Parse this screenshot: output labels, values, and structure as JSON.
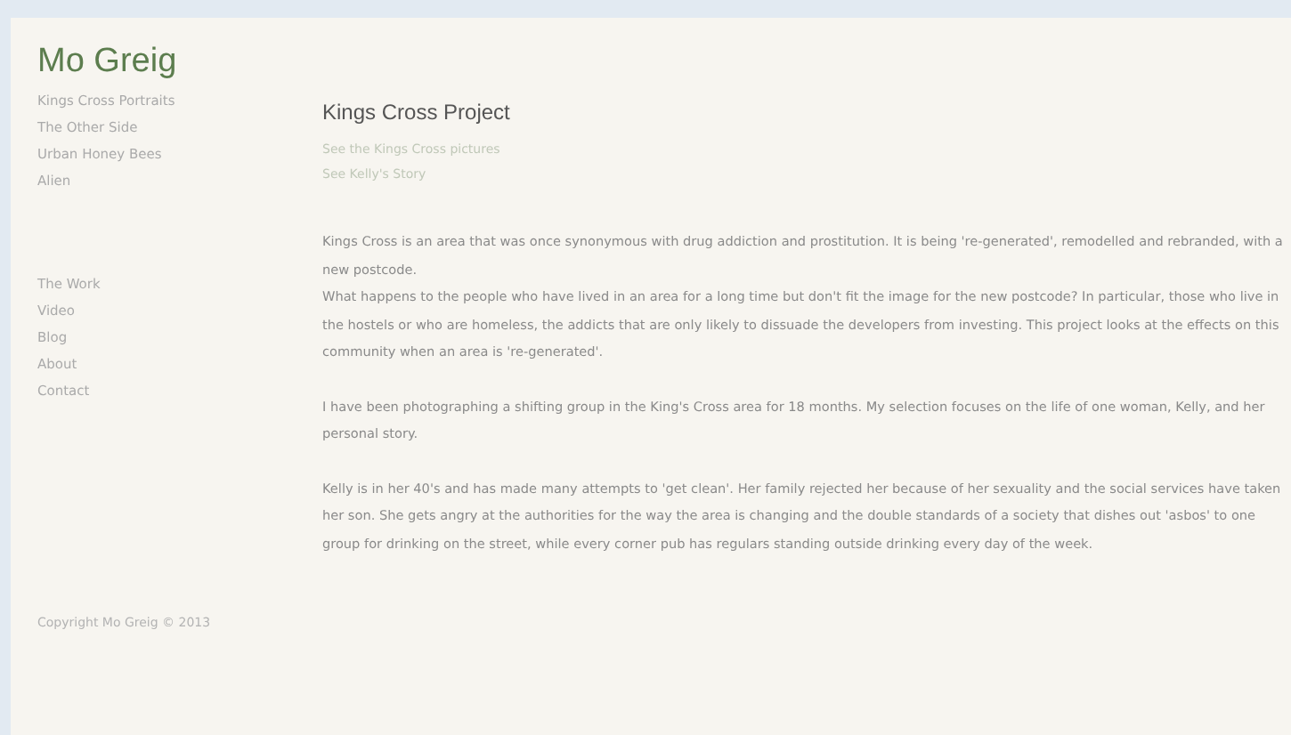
{
  "site_title": "Mo Greig",
  "projects": [
    "Kings Cross Portraits",
    "The Other Side",
    "Urban Honey Bees",
    "Alien"
  ],
  "nav": [
    "The Work",
    "Video",
    "Blog",
    "About",
    "Contact"
  ],
  "copyright": "Copyright Mo Greig © 2013",
  "page_title": "Kings Cross Project",
  "page_links": [
    "See the Kings Cross pictures",
    "See Kelly's Story"
  ],
  "paragraphs": [
    {
      "lines": [
        "Kings Cross is an area that was once synonymous with drug addiction and prostitution. It is being 're-generated', remodelled and rebranded, with a new postcode.",
        "What happens to the people who have lived in an area for a long time but don't fit the image for the new postcode? In particular, those who live in the hostels or who are homeless, the addicts that are only likely to dissuade the developers from investing. This project looks at the effects on this community when an area is 're-generated'."
      ]
    },
    {
      "lines": [
        "I have been photographing a shifting group in the King's Cross area for 18 months. My selection focuses on the life of one woman, Kelly, and her personal story."
      ]
    },
    {
      "lines": [
        "Kelly is in her 40's and has made many attempts to 'get clean'. Her family rejected her because of her sexuality and the social services have taken her son.  She gets angry at the authorities for the way the area is changing and the double standards of a society that dishes out 'asbos' to one group for drinking on the street, while every corner pub has regulars standing outside drinking every day of the week."
      ]
    }
  ]
}
